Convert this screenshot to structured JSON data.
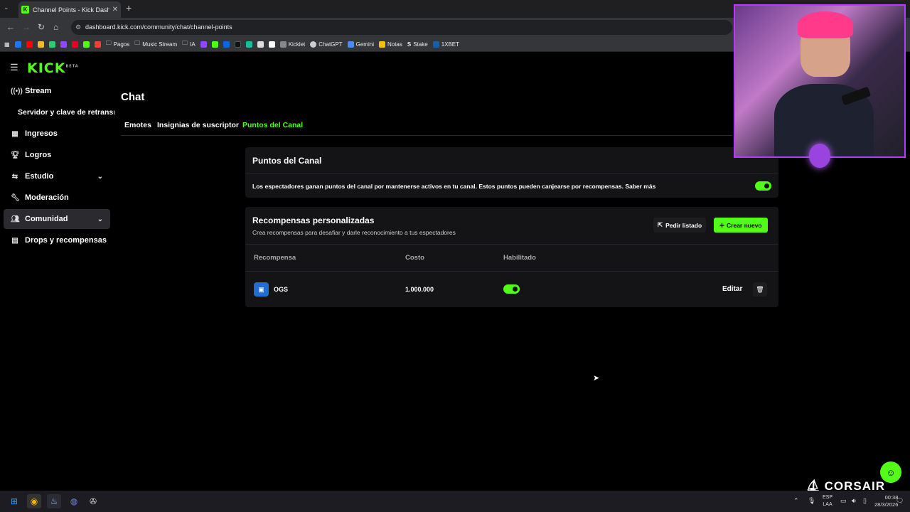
{
  "browser": {
    "tab_title": "Channel Points - Kick Dashboar",
    "tab_close": "✕",
    "url": "dashboard.kick.com/community/chat/channel-points",
    "bookmarks": [
      "Pagos",
      "Music Stream",
      "IA",
      "Kicklet",
      "ChatGPT",
      "Gemini",
      "Notas",
      "Stake",
      "1XBET"
    ]
  },
  "sidebar": {
    "logo": "KICK",
    "logo_badge": "BETA",
    "items": [
      {
        "label": "Stream",
        "icon": "stream-icon"
      },
      {
        "label": "Servidor y clave de retransmisión",
        "icon": ""
      },
      {
        "label": "Ingresos",
        "icon": "revenue-icon"
      },
      {
        "label": "Logros",
        "icon": "trophy-icon"
      },
      {
        "label": "Estudio",
        "icon": "studio-icon"
      },
      {
        "label": "Moderación",
        "icon": "wrench-icon"
      },
      {
        "label": "Comunidad",
        "icon": "community-icon"
      },
      {
        "label": "Drops y recompensas",
        "icon": "drops-icon"
      }
    ]
  },
  "page": {
    "title": "Chat",
    "tabs": [
      "Emotes",
      "Insignias de suscriptor",
      "Puntos del Canal"
    ],
    "active_tab": "Puntos del Canal"
  },
  "channel_points": {
    "header": "Puntos del Canal",
    "description": "Los espectadores ganan puntos del canal por mantenerse activos en tu canal. Estos puntos pueden canjearse por recompensas. Saber más",
    "enabled": true
  },
  "rewards": {
    "header": "Recompensas personalizadas",
    "subtitle": "Crea recompensas para desafiar y darle reconocimiento a tus espectadores",
    "request_list_label": "Pedir listado",
    "create_label": "Crear nuevo",
    "columns": [
      "Recompensa",
      "Costo",
      "Habilitado"
    ],
    "rows": [
      {
        "name": "OGS",
        "cost": "1.000.000",
        "enabled": true,
        "edit_label": "Editar"
      }
    ]
  },
  "overlay": {
    "brand": "CORSAIR"
  },
  "taskbar": {
    "lang_line1": "ESP",
    "lang_line2": "LAA",
    "time": "00:38",
    "date": "28/3/2026"
  },
  "colors": {
    "accent": "#53fc18",
    "background": "#000000",
    "card": "#141416"
  }
}
